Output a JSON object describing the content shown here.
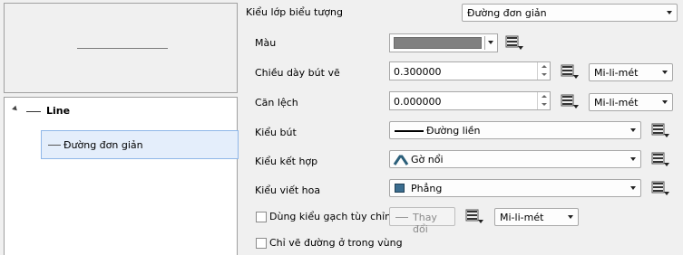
{
  "layer_type": {
    "label": "Kiểu lớp biểu tượng",
    "value": "Đường đơn giản"
  },
  "tree": {
    "parent": "Line",
    "child": "Đường đơn giản"
  },
  "color": {
    "label": "Màu",
    "value": "#808080"
  },
  "stroke_width": {
    "label": "Chiều dày bút vẽ",
    "value": "0.300000",
    "unit": "Mi-li-mét"
  },
  "offset": {
    "label": "Căn lệch",
    "value": "0.000000",
    "unit": "Mi-li-mét"
  },
  "pen_style": {
    "label": "Kiểu bút",
    "value": "Đường liền"
  },
  "join_style": {
    "label": "Kiểu kết hợp",
    "value": "Gờ nổi"
  },
  "cap_style": {
    "label": "Kiểu viết hoa",
    "value": "Phẳng"
  },
  "custom_dash": {
    "label": "Dùng kiểu gạch tùy chỉnh",
    "button": "Thay đổi",
    "unit": "Mi-li-mét",
    "checked": false
  },
  "draw_inside": {
    "label": "Chỉ vẽ đường ở trong vùng",
    "checked": false
  },
  "icons": {
    "data_defined": "data-defined-override-icon",
    "expander": "expand-triangle-icon",
    "join": "bevel-join-icon",
    "cap": "flat-cap-icon"
  }
}
